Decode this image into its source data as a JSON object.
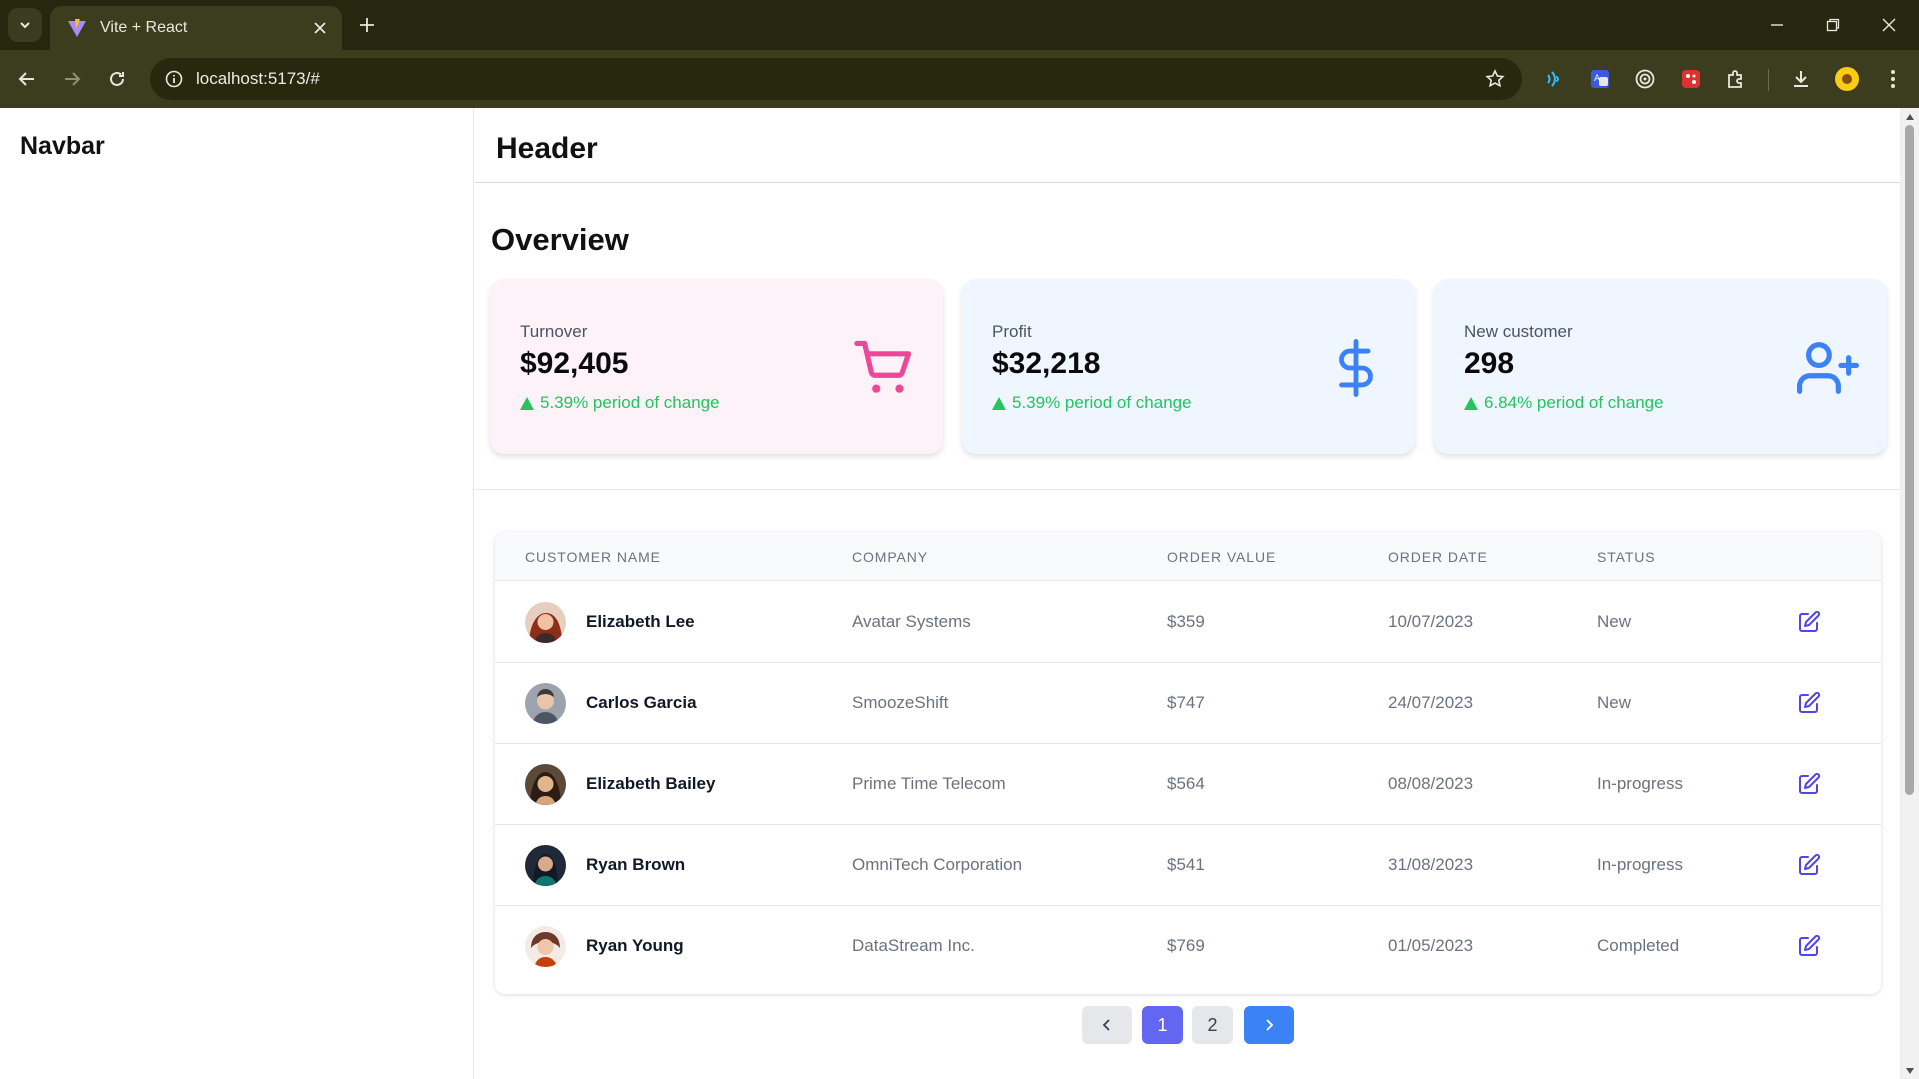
{
  "browser": {
    "tab_title": "Vite + React",
    "url": "localhost:5173/#"
  },
  "navbar": {
    "title": "Navbar"
  },
  "header": {
    "title": "Header"
  },
  "overview": {
    "title": "Overview",
    "cards": [
      {
        "label": "Turnover",
        "value": "$92,405",
        "change": "5.39% period of change",
        "icon": "cart-icon",
        "bg": "#fdf2f8",
        "icon_color": "#ec4899"
      },
      {
        "label": "Profit",
        "value": "$32,218",
        "change": "5.39% period of change",
        "icon": "dollar-icon",
        "bg": "#eff6ff",
        "icon_color": "#3b82f6"
      },
      {
        "label": "New customer",
        "value": "298",
        "change": "6.84% period of change",
        "icon": "user-plus-icon",
        "bg": "#eff6ff",
        "icon_color": "#3b82f6"
      }
    ]
  },
  "table": {
    "columns": [
      "CUSTOMER NAME",
      "COMPANY",
      "ORDER VALUE",
      "ORDER DATE",
      "STATUS"
    ],
    "rows": [
      {
        "name": "Elizabeth Lee",
        "company": "Avatar Systems",
        "value": "$359",
        "date": "10/07/2023",
        "status": "New"
      },
      {
        "name": "Carlos Garcia",
        "company": "SmoozeShift",
        "value": "$747",
        "date": "24/07/2023",
        "status": "New"
      },
      {
        "name": "Elizabeth Bailey",
        "company": "Prime Time Telecom",
        "value": "$564",
        "date": "08/08/2023",
        "status": "In-progress"
      },
      {
        "name": "Ryan Brown",
        "company": "OmniTech Corporation",
        "value": "$541",
        "date": "31/08/2023",
        "status": "In-progress"
      },
      {
        "name": "Ryan Young",
        "company": "DataStream Inc.",
        "value": "$769",
        "date": "01/05/2023",
        "status": "Completed"
      }
    ]
  },
  "pagination": {
    "pages": [
      "1",
      "2"
    ],
    "current": "1"
  },
  "colors": {
    "browser_frame": "#27270f",
    "accent_purple": "#6366f1",
    "accent_blue": "#3b82f6",
    "positive_green": "#22c55e",
    "edit_icon": "#4f46e5"
  }
}
